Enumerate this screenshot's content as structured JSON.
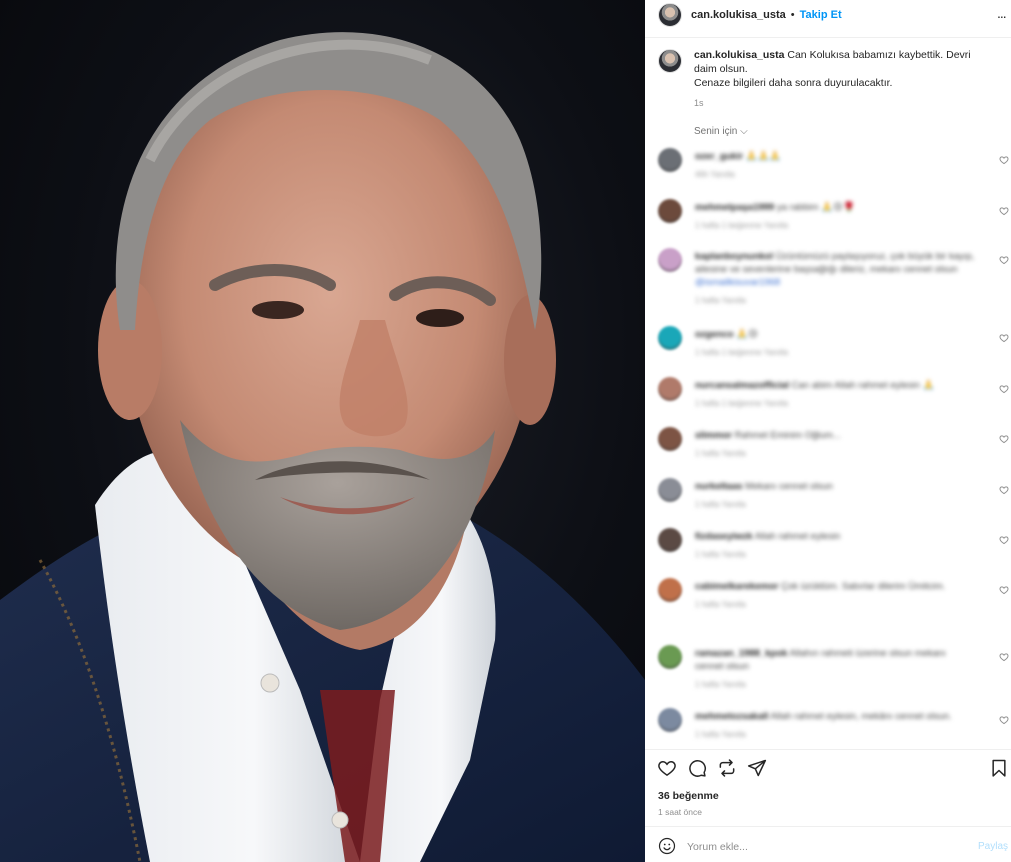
{
  "post": {
    "username": "can.kolukisa_usta",
    "separator": "•",
    "follow_label": "Takip Et",
    "more_label": "...",
    "caption_username": "can.kolukisa_usta",
    "caption_text": " Can Kolukısa babamızı kaybettik. Devri daim olsun.",
    "caption_line2": "Cenaze bilgileri daha sonra duyurulacaktır.",
    "caption_time": "1s"
  },
  "comments_filter": "Senin için ⌵",
  "comments": [
    {
      "user": "ozer_gukir",
      "text": "🙏🙏🙏",
      "meta": "46h  Yanıtla",
      "avatar_color": "#6b6f75"
    },
    {
      "user": "mehmetpaşa1999",
      "text": "ya rabbim 🙏😢🌹",
      "meta": "1 hafta  1 beğenme  Yanıtla",
      "avatar_color": "#6c4a3c"
    },
    {
      "user": "kaplanboynunkol",
      "text": "Üzüntümüzü paylaşıyoruz, çok büyük bir kayıp, ailesine ve sevenlerine başsağlığı dileriz, mekanı cennet olsun",
      "mention": "@ismailkisuvar1968",
      "meta": "1 hafta  Yanıtla",
      "avatar_color": "#c9a0c8"
    },
    {
      "user": "ozgenco",
      "text": "🙏😢",
      "meta": "1 hafta  1 beğenme  Yanıtla",
      "avatar_color": "#1aa7b8"
    },
    {
      "user": "nurcansalmazofficial",
      "text": "Can abim Allah rahmet eylesin 🙏",
      "meta": "1 hafta  1 beğenme  Yanıtla",
      "avatar_color": "#b07a6a"
    },
    {
      "user": "slimmor",
      "text": "Rahmet Eminim Oğlum...",
      "meta": "1 hafta  Yanıtla",
      "avatar_color": "#7d5444"
    },
    {
      "user": "nurkeltaas",
      "text": "Mekanı cennet olsun",
      "meta": "1 hafta  Yanıtla",
      "avatar_color": "#8a8d96"
    },
    {
      "user": "fizdaseyiwzk",
      "text": "Allah rahmet eylesin",
      "meta": "1 hafta  Yanıtla",
      "avatar_color": "#5b4a44"
    },
    {
      "user": "cabimelkarekemor",
      "text": "Çok üzüldüm. Sabırlar dilerim Ümitcim.",
      "meta": "1 hafta  Yanıtla",
      "avatar_color": "#c0704a"
    },
    {
      "user": "ramazan_1988_kpok",
      "text": "Allahın rahmeti üzerine olsun mekanı cennet olsun",
      "meta": "1 hafta  Yanıtla",
      "avatar_color": "#6a9a52"
    },
    {
      "user": "mehmetozsakall",
      "text": "Allah rahmet eylesin, mekânı cennet olsun.",
      "meta": "1 hafta  Yanıtla",
      "avatar_color": "#7c8aa0"
    }
  ],
  "likes": "36 beğenme",
  "time_ago": "1 saat önce",
  "comment_box": {
    "placeholder": "Yorum ekle...",
    "share_label": "Paylaş"
  },
  "colors": {
    "link_blue": "#0095f6",
    "share_disabled": "#b2dffc",
    "meta_gray": "#8e8e8e"
  },
  "icons": [
    "heart-icon",
    "comment-icon",
    "repost-icon",
    "share-icon",
    "bookmark-icon",
    "emoji-icon"
  ]
}
